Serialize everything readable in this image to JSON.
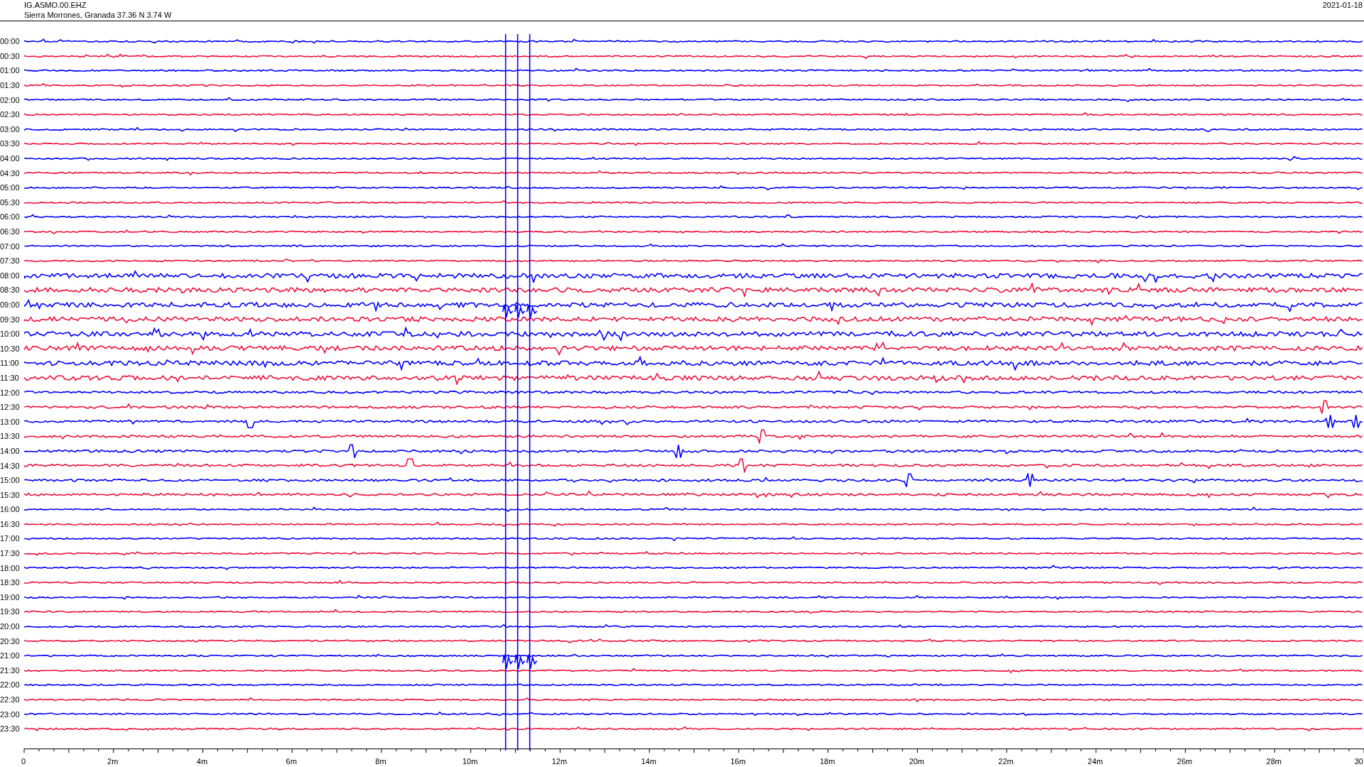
{
  "header": {
    "channel": "IG.ASMO.00.EHZ",
    "location": "Sierra Morrones, Granada  37.36 N 3.74 W",
    "date": "2021-01-18"
  },
  "rows": [
    {
      "time": "00:00",
      "color": "#0000ff"
    },
    {
      "time": "00:30",
      "color": "#f0103a"
    },
    {
      "time": "01:00",
      "color": "#0000ff"
    },
    {
      "time": "01:30",
      "color": "#f0103a"
    },
    {
      "time": "02:00",
      "color": "#0000ff"
    },
    {
      "time": "02:30",
      "color": "#f0103a"
    },
    {
      "time": "03:00",
      "color": "#0000ff"
    },
    {
      "time": "03:30",
      "color": "#f0103a"
    },
    {
      "time": "04:00",
      "color": "#0000ff"
    },
    {
      "time": "04:30",
      "color": "#f0103a"
    },
    {
      "time": "05:00",
      "color": "#0000ff"
    },
    {
      "time": "05:30",
      "color": "#f0103a"
    },
    {
      "time": "06:00",
      "color": "#0000ff"
    },
    {
      "time": "06:30",
      "color": "#f0103a"
    },
    {
      "time": "07:00",
      "color": "#0000ff"
    },
    {
      "time": "07:30",
      "color": "#f0103a"
    },
    {
      "time": "08:00",
      "color": "#0000ff"
    },
    {
      "time": "08:30",
      "color": "#f0103a"
    },
    {
      "time": "09:00",
      "color": "#0000ff"
    },
    {
      "time": "09:30",
      "color": "#f0103a"
    },
    {
      "time": "10:00",
      "color": "#0000ff"
    },
    {
      "time": "10:30",
      "color": "#f0103a"
    },
    {
      "time": "11:00",
      "color": "#0000ff"
    },
    {
      "time": "11:30",
      "color": "#f0103a"
    },
    {
      "time": "12:00",
      "color": "#0000ff"
    },
    {
      "time": "12:30",
      "color": "#f0103a"
    },
    {
      "time": "13:00",
      "color": "#0000ff"
    },
    {
      "time": "13:30",
      "color": "#f0103a"
    },
    {
      "time": "14:00",
      "color": "#0000ff"
    },
    {
      "time": "14:30",
      "color": "#f0103a"
    },
    {
      "time": "15:00",
      "color": "#0000ff"
    },
    {
      "time": "15:30",
      "color": "#f0103a"
    },
    {
      "time": "16:00",
      "color": "#0000ff"
    },
    {
      "time": "16:30",
      "color": "#f0103a"
    },
    {
      "time": "17:00",
      "color": "#0000ff"
    },
    {
      "time": "17:30",
      "color": "#f0103a"
    },
    {
      "time": "18:00",
      "color": "#0000ff"
    },
    {
      "time": "18:30",
      "color": "#f0103a"
    },
    {
      "time": "19:00",
      "color": "#0000ff"
    },
    {
      "time": "19:30",
      "color": "#f0103a"
    },
    {
      "time": "20:00",
      "color": "#0000ff"
    },
    {
      "time": "20:30",
      "color": "#f0103a"
    },
    {
      "time": "21:00",
      "color": "#0000ff"
    },
    {
      "time": "21:30",
      "color": "#f0103a"
    },
    {
      "time": "22:00",
      "color": "#0000ff"
    },
    {
      "time": "22:30",
      "color": "#f0103a"
    },
    {
      "time": "23:00",
      "color": "#0000ff"
    },
    {
      "time": "23:30",
      "color": "#f0103a"
    }
  ],
  "x_axis": {
    "labels": [
      "0",
      "2m",
      "4m",
      "6m",
      "8m",
      "10m",
      "12m",
      "14m",
      "16m",
      "18m",
      "20m",
      "22m",
      "24m",
      "26m",
      "28m",
      "30"
    ]
  }
}
